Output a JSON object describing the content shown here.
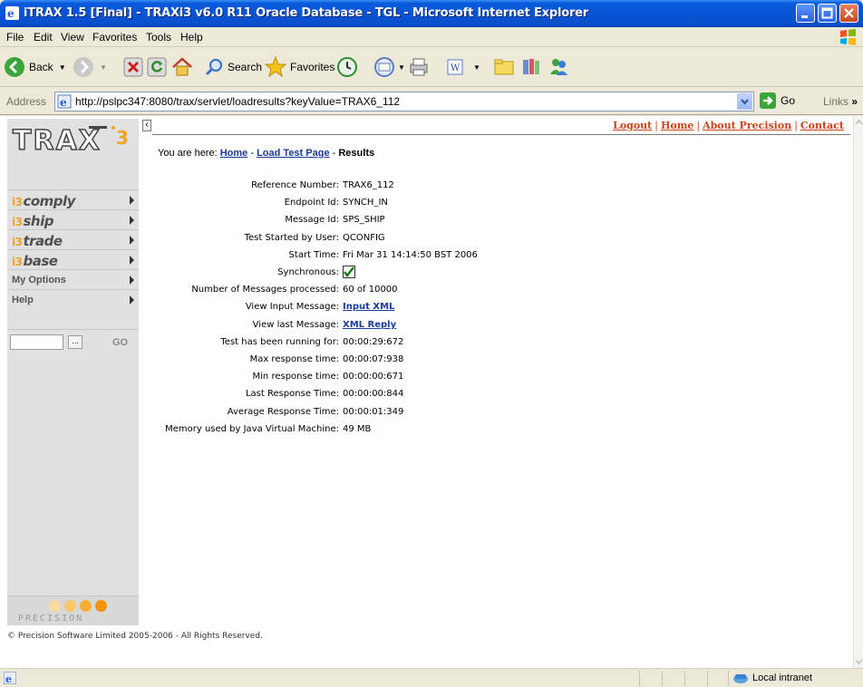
{
  "window": {
    "title": "iTRAX 1.5 [Final] - TRAXi3 v6.0 R11 Oracle Database - TGL - Microsoft Internet Explorer"
  },
  "menu": [
    "File",
    "Edit",
    "View",
    "Favorites",
    "Tools",
    "Help"
  ],
  "toolbar": {
    "back": "Back",
    "search": "Search",
    "favorites": "Favorites"
  },
  "address": {
    "label": "Address",
    "url": "http://pslpc347:8080/trax/servlet/loadresults?keyValue=TRAX6_112",
    "go": "Go",
    "links": "Links"
  },
  "sidebar": {
    "logo_text": "TRAX",
    "logo_suffix": "i3",
    "items": [
      {
        "num": "i3",
        "label": "comply"
      },
      {
        "num": "i3",
        "label": "ship"
      },
      {
        "num": "i3",
        "label": "trade"
      },
      {
        "num": "i3",
        "label": "base"
      },
      {
        "label": "My Options"
      },
      {
        "label": "Help"
      }
    ],
    "search_button": "...",
    "go": "GO",
    "precision": "PRECISION"
  },
  "toplinks": [
    "Logout",
    "Home",
    "About Precision",
    "Contact"
  ],
  "breadcrumb": {
    "prefix": "You are here:",
    "home": "Home",
    "load": "Load Test Page",
    "current": "Results",
    "sep": "-"
  },
  "results": [
    {
      "label": "Reference Number:",
      "value": "TRAX6_112"
    },
    {
      "label": "Endpoint Id:",
      "value": "SYNCH_IN"
    },
    {
      "label": "Message Id:",
      "value": "SPS_SHIP"
    },
    {
      "label": "Test Started by User:",
      "value": "QCONFIG"
    },
    {
      "label": "Start Time:",
      "value": "Fri Mar 31 14:14:50 BST 2006"
    },
    {
      "label": "Synchronous:",
      "value": "",
      "checkbox": true
    },
    {
      "label": "Number of Messages processed:",
      "value": "60 of 10000"
    },
    {
      "label": "View Input Message:",
      "value": "Input XML",
      "link": true
    },
    {
      "label": "View last Message:",
      "value": "XML Reply",
      "link": true
    },
    {
      "label": "Test has been running for:",
      "value": "00:00:29:672"
    },
    {
      "label": "Max response time:",
      "value": "00:00:07:938"
    },
    {
      "label": "Min response time:",
      "value": "00:00:00:671"
    },
    {
      "label": "Last Response Time:",
      "value": "00:00:00:844"
    },
    {
      "label": "Average Response Time:",
      "value": "00:00:01:349"
    },
    {
      "label": "Memory used by Java Virtual Machine:",
      "value": "49 MB"
    }
  ],
  "copyright": "© Precision Software Limited 2005-2006 - All Rights Reserved.",
  "status": {
    "zone": "Local intranet"
  },
  "colors": {
    "link": "#1a3a9c",
    "toplink": "#c8441c",
    "accent": "#f2a21a",
    "titlebar": "#0754d6"
  }
}
